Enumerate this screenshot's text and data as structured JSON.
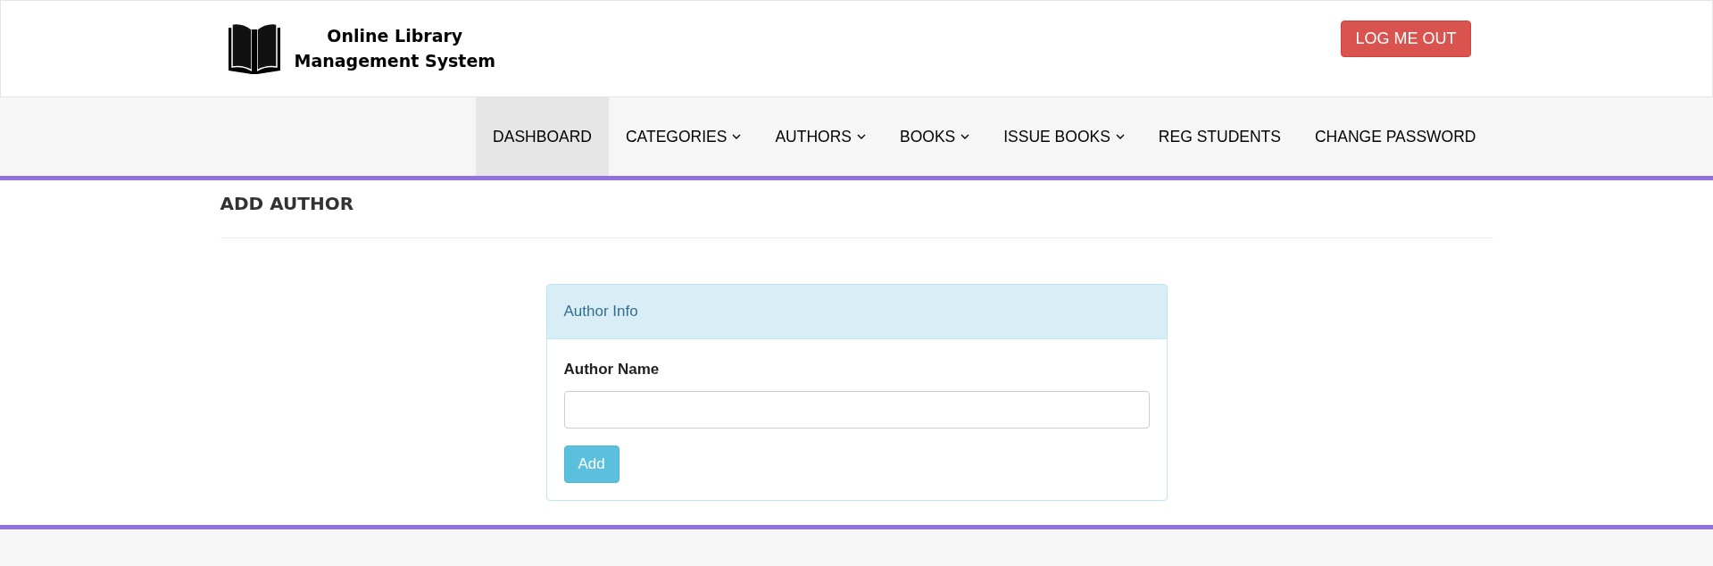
{
  "header": {
    "brand_line_1": "Online Library",
    "brand_line_2": "Management System",
    "logout_button": "LOG ME OUT"
  },
  "nav": [
    {
      "label": "DASHBOARD",
      "selected": true,
      "dropdown": false
    },
    {
      "label": "CATEGORIES",
      "selected": false,
      "dropdown": true
    },
    {
      "label": "AUTHORS",
      "selected": false,
      "dropdown": true
    },
    {
      "label": "BOOKS",
      "selected": false,
      "dropdown": true
    },
    {
      "label": "ISSUE BOOKS",
      "selected": false,
      "dropdown": true
    },
    {
      "label": "REG STUDENTS",
      "selected": false,
      "dropdown": false
    },
    {
      "label": "CHANGE PASSWORD",
      "selected": false,
      "dropdown": false
    }
  ],
  "page_title": "ADD AUTHOR",
  "panel": {
    "heading": "Author Info",
    "field_label": "Author Name",
    "submit_button": "Add"
  }
}
